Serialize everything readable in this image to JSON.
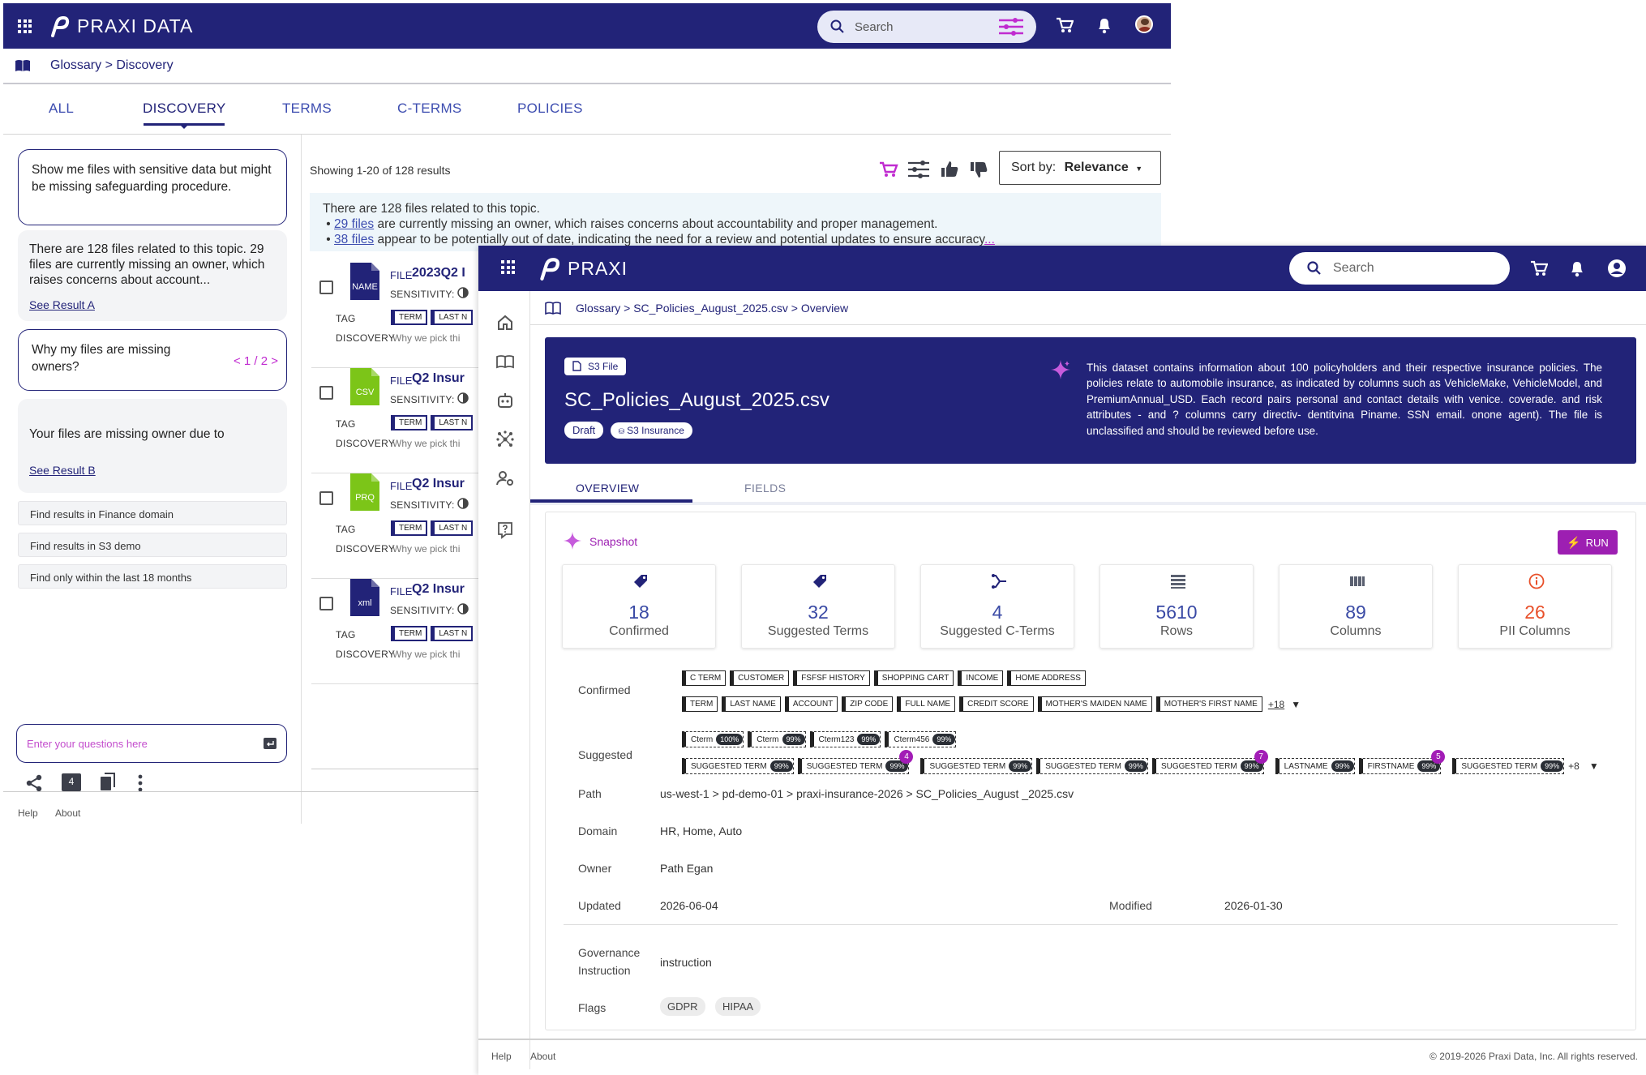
{
  "win1": {
    "brand": "PRAXI DATA",
    "search_placeholder": "Search",
    "breadcrumb": "Glossary > Discovery",
    "tabs": [
      "ALL",
      "DISCOVERY",
      "TERMS",
      "C-TERMS",
      "POLICIES"
    ],
    "chat": {
      "q1": "Show me files with sensitive data but might be missing safeguarding procedure.",
      "a1": "There are 128 files related to this topic. 29 files are currently missing an owner, which raises concerns about account...",
      "a1_link": "See Result A",
      "q2": "Why my files are missing owners?",
      "q2_pager": "< 1 / 2 >",
      "a2": "Your files are missing owner due to",
      "a2_link": "See Result B",
      "suggestions": [
        "Find results in Finance domain",
        "Find results in S3 demo",
        "Find only within the last 18 months"
      ],
      "input_placeholder": "Enter your questions here",
      "bottom_badge": "4"
    },
    "results": {
      "showing": "Showing 1-20 of 128 results",
      "sort_label": "Sort by:",
      "sort_value": "Relevance",
      "summary_line": "There are 128 files related to this topic.",
      "summary_b1_link": "29 files",
      "summary_b1_rest": " are currently missing an owner, which raises concerns about accountability and proper management.",
      "summary_b2_link": "38 files",
      "summary_b2_rest": " appear to be potentially out of date, indicating the need for a review and potential updates to ensure accuracy",
      "summary_more": "...",
      "rows": [
        {
          "icon": "NAME",
          "icon_color": "#222378",
          "type": "FILE",
          "title": "2023Q2 I",
          "sensitivity": "SENSITIVITY:",
          "tag_label": "TAG",
          "tag1": "TERM",
          "tag2": "LAST N",
          "disc_label": "DISCOVERY",
          "why": "Why we pick thi"
        },
        {
          "icon": "CSV",
          "icon_color": "#7cc518",
          "type": "FILE",
          "title": "Q2 Insur",
          "sensitivity": "SENSITIVITY:",
          "tag_label": "TAG",
          "tag1": "TERM",
          "tag2": "LAST N",
          "disc_label": "DISCOVERY",
          "why": "Why we pick thi"
        },
        {
          "icon": "PRQ",
          "icon_color": "#7cc518",
          "type": "FILE",
          "title": "Q2 Insur",
          "sensitivity": "SENSITIVITY:",
          "tag_label": "TAG",
          "tag1": "TERM",
          "tag2": "LAST N",
          "disc_label": "DISCOVERY",
          "why": "Why we pick thi"
        },
        {
          "icon": "xml",
          "icon_color": "#222378",
          "type": "FILE",
          "title": "Q2 Insur",
          "sensitivity": "SENSITIVITY:",
          "tag_label": "TAG",
          "tag1": "TERM",
          "tag2": "LAST N",
          "disc_label": "DISCOVERY",
          "why": "Why we pick thi"
        }
      ]
    },
    "footer": {
      "help": "Help",
      "about": "About"
    }
  },
  "win2": {
    "brand": "PRAXI",
    "search_placeholder": "Search",
    "breadcrumb": "Glossary > SC_Policies_August_2025.csv > Overview",
    "file_badge": "S3 File",
    "title": "SC_Policies_August_2025.csv",
    "status_badge": "Draft",
    "source_badge": "S3 Insurance",
    "description": "This dataset contains information about 100 policyholders and their respective insurance policies. The policies relate to automobile insurance, as indicated by columns such as VehicleMake, VehicleModel, and PremiumAnnual_USD. Each record pairs personal and contact details with venice. coverade. and risk attributes - and ? columns carry directiv- dentitvina Piname. SSN email. onone agent). The file is unclassified and should be reviewed before use.",
    "tabs": [
      "OVERVIEW",
      "FIELDS"
    ],
    "snapshot_label": "Snapshot",
    "run_label": "RUN",
    "stats": [
      {
        "value": "18",
        "caption": "Confirmed",
        "icon": "tag-icon"
      },
      {
        "value": "32",
        "caption": "Suggested Terms",
        "icon": "tag-icon"
      },
      {
        "value": "4",
        "caption": "Suggested C-Terms",
        "icon": "branch-icon"
      },
      {
        "value": "5610",
        "caption": "Rows",
        "icon": "rows-icon"
      },
      {
        "value": "89",
        "caption": "Columns",
        "icon": "columns-icon"
      },
      {
        "value": "26",
        "caption": "PII Columns",
        "icon": "info-icon"
      }
    ],
    "confirmed_label": "Confirmed",
    "confirmed_row1": [
      "C TERM",
      "CUSTOMER",
      "FSFSF HISTORY",
      "SHOPPING CART",
      "INCOME",
      "HOME ADDRESS"
    ],
    "confirmed_row2": [
      "TERM",
      "LAST NAME",
      "ACCOUNT",
      "ZIP CODE",
      "FULL NAME",
      "CREDIT SCORE",
      "MOTHER'S MAIDEN NAME",
      "MOTHER'S FIRST NAME"
    ],
    "confirmed_more": "+18",
    "suggested_label": "Suggested",
    "suggested_row1": [
      {
        "label": "Cterm",
        "pct": "100%"
      },
      {
        "label": "Cterm",
        "pct": "99%"
      },
      {
        "label": "Cterm123",
        "pct": "99%"
      },
      {
        "label": "Cterm456",
        "pct": "99%"
      }
    ],
    "suggested_row2": [
      {
        "label": "SUGGESTED TERM",
        "pct": "99%",
        "note": ""
      },
      {
        "label": "SUGGESTED TERM",
        "pct": "99%",
        "note": "4"
      },
      {
        "label": "SUGGESTED TERM",
        "pct": "99%",
        "note": ""
      },
      {
        "label": "SUGGESTED TERM",
        "pct": "99%",
        "note": ""
      },
      {
        "label": "SUGGESTED TERM",
        "pct": "99%",
        "note": "7"
      },
      {
        "label": "LASTNAME",
        "pct": "99%",
        "note": ""
      },
      {
        "label": "FIRSTNAME",
        "pct": "99%",
        "note": "5"
      },
      {
        "label": "SUGGESTED TERM",
        "pct": "99%",
        "note": ""
      }
    ],
    "suggested_more": "+8",
    "path_label": "Path",
    "path_value": "us-west-1 > pd-demo-01 > praxi-insurance-2026 > SC_Policies_August _2025.csv",
    "domain_label": "Domain",
    "domain_value": "HR, Home, Auto",
    "owner_label": "Owner",
    "owner_value": "Path Egan",
    "updated_label": "Updated",
    "updated_value": "2026-06-04",
    "modified_label": "Modified",
    "modified_value": "2026-01-30",
    "gov_label": "Governance Instruction",
    "gov_value": "instruction",
    "flags_label": "Flags",
    "flags": [
      "GDPR",
      "HIPAA"
    ],
    "footer": {
      "help": "Help",
      "about": "About",
      "copyright": "© 2019-2026 Praxi Data, Inc. All rights reserved."
    }
  }
}
